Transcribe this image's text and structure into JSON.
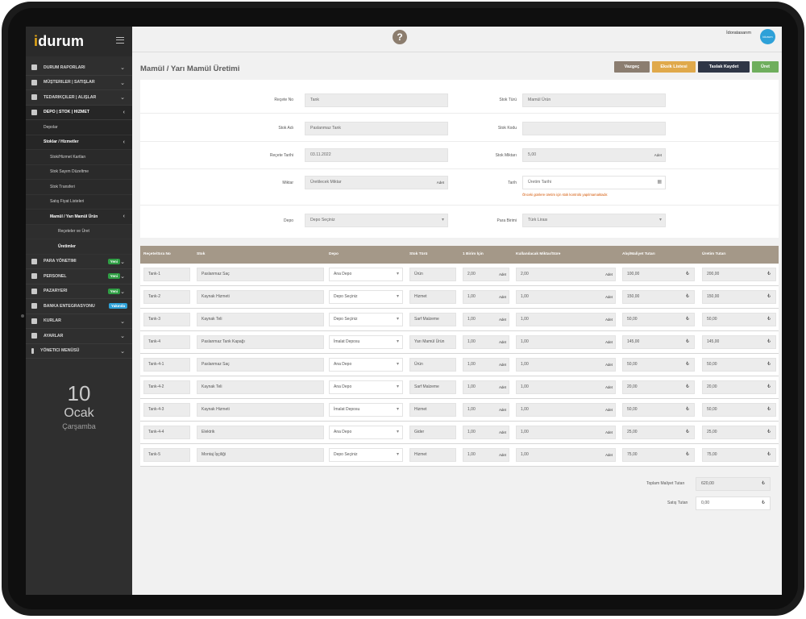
{
  "app": {
    "logo_i": "i",
    "logo_rest": "durum"
  },
  "sidebar": {
    "items": [
      {
        "label": "Durum Raporları"
      },
      {
        "label": "Müşteriler | Satışlar"
      },
      {
        "label": "Tedarikçiler | Alışlar"
      },
      {
        "label": "Depo | Stok | Hizmet"
      }
    ],
    "sub": {
      "depolar": "Depolar",
      "stoklar": "Stoklar / Hizmetler",
      "kartlari": "Stok/Hizmet Kartları",
      "sayim": "Stok Sayım Düzeltme",
      "transfer": "Stok Transferi",
      "fiyat": "Satış Fiyat Listeleri",
      "mamul": "Mamül / Yarı Mamül Ürün",
      "recete": "Reçeteler ve Üret",
      "uretimler": "Üretimler"
    },
    "items2": [
      {
        "label": "Para Yönetimi",
        "badge": "Yeni",
        "badge_color": "#2f9e44"
      },
      {
        "label": "Personel",
        "badge": "Yeni",
        "badge_color": "#2f9e44"
      },
      {
        "label": "Pazaryeri",
        "badge": "Yeni",
        "badge_color": "#2f9e44"
      },
      {
        "label": "Banka Entegrasyonu",
        "badge": "Yakında",
        "badge_color": "#2ea1d8"
      },
      {
        "label": "Kurlar",
        "badge": "",
        "badge_color": ""
      },
      {
        "label": "Ayarlar",
        "badge": "",
        "badge_color": ""
      },
      {
        "label": "Yönetici Menüsü",
        "badge": "",
        "badge_color": ""
      }
    ],
    "date": {
      "day": "10",
      "month": "Ocak",
      "weekday": "Çarşamba"
    }
  },
  "topbar": {
    "help": "?",
    "user": "İdoratasarım",
    "avatar": "idurum"
  },
  "page": {
    "title": "Mamül / Yarı Mamül Üretimi"
  },
  "buttons": {
    "vazgec": "Vazgeç",
    "eksik": "Eksik Listesi",
    "taslak": "Taslak Kaydet",
    "uret": "Üret"
  },
  "form": {
    "recete_no": {
      "label": "Reçete No",
      "value": "Tank"
    },
    "stok_turu": {
      "label": "Stok Türü",
      "value": "Mamül Ürün"
    },
    "stok_adi": {
      "label": "Stok Adı",
      "value": "Paslanmaz Tank"
    },
    "stok_kodu": {
      "label": "Stok Kodu",
      "value": ""
    },
    "recete_tarihi": {
      "label": "Reçete Tarihi",
      "value": "03.11.2022"
    },
    "stok_miktari": {
      "label": "Stok Miktarı",
      "value": "5,00",
      "unit": "Adet"
    },
    "miktar": {
      "label": "Miktar",
      "placeholder": "Üretilecek Miktar",
      "unit": "Adet"
    },
    "tarih": {
      "label": "Tarih",
      "placeholder": "Üretim Tarihi",
      "warning": "Önceki günlere üretim için stok kontrolü yapılmamaktadır."
    },
    "depo": {
      "label": "Depo",
      "value": "Depo Seçiniz"
    },
    "para_birimi": {
      "label": "Para Birimi",
      "value": "Türk Lirası"
    }
  },
  "table": {
    "headers": [
      "Reçete/Sıra No",
      "Stok",
      "Depo",
      "Stok Türü",
      "1 Birim İçin",
      "Kullanılacak Miktar/Süre",
      "Alış/Maliyet Tutarı",
      "Üretim Tutarı"
    ],
    "unit": "Adet",
    "currency": "₺",
    "rows": [
      {
        "no": "Tank-1",
        "stok": "Paslanmaz Saç",
        "depo": "Ana Depo",
        "tur": "Ürün",
        "birim": "2,00",
        "miktar": "2,00",
        "maliyet": "100,00",
        "uretim": "200,00"
      },
      {
        "no": "Tank-2",
        "stok": "Kaynak Hizmeti",
        "depo": "Depo Seçiniz",
        "tur": "Hizmet",
        "birim": "1,00",
        "miktar": "1,00",
        "maliyet": "150,00",
        "uretim": "150,00"
      },
      {
        "no": "Tank-3",
        "stok": "Kaynak Teli",
        "depo": "Depo Seçiniz",
        "tur": "Sarf Malzeme",
        "birim": "1,00",
        "miktar": "1,00",
        "maliyet": "50,00",
        "uretim": "50,00"
      },
      {
        "no": "Tank-4",
        "stok": "Paslanmaz Tank Kapağı",
        "depo": "İmalat Deposu",
        "tur": "Yarı Mamül Ürün",
        "birim": "1,00",
        "miktar": "1,00",
        "maliyet": "145,00",
        "uretim": "145,00"
      },
      {
        "no": "Tank-4-1",
        "stok": "Paslanmaz Saç",
        "depo": "Ana Depo",
        "tur": "Ürün",
        "birim": "1,00",
        "miktar": "1,00",
        "maliyet": "50,00",
        "uretim": "50,00"
      },
      {
        "no": "Tank-4-2",
        "stok": "Kaynak Teli",
        "depo": "Ana Depo",
        "tur": "Sarf Malzeme",
        "birim": "1,00",
        "miktar": "1,00",
        "maliyet": "20,00",
        "uretim": "20,00"
      },
      {
        "no": "Tank-4-3",
        "stok": "Kaynak Hizmeti",
        "depo": "İmalat Deposu",
        "tur": "Hizmet",
        "birim": "1,00",
        "miktar": "1,00",
        "maliyet": "50,00",
        "uretim": "50,00"
      },
      {
        "no": "Tank-4-4",
        "stok": "Elektrik",
        "depo": "Ana Depo",
        "tur": "Gider",
        "birim": "1,00",
        "miktar": "1,00",
        "maliyet": "25,00",
        "uretim": "25,00"
      },
      {
        "no": "Tank-5",
        "stok": "Montaj İşçiliği",
        "depo": "Depo Seçiniz",
        "tur": "Hizmet",
        "birim": "1,00",
        "miktar": "1,00",
        "maliyet": "75,00",
        "uretim": "75,00"
      }
    ]
  },
  "totals": {
    "maliyet_label": "Toplam Maliyet Tutarı",
    "maliyet_value": "620,00",
    "satis_label": "Satış Tutarı",
    "satis_value": "0,00"
  },
  "colors": {
    "vazgec": "#8b7d70",
    "eksik": "#e0a94b",
    "taslak": "#2f3646",
    "uret": "#6fae5d",
    "header": "#a49888"
  }
}
